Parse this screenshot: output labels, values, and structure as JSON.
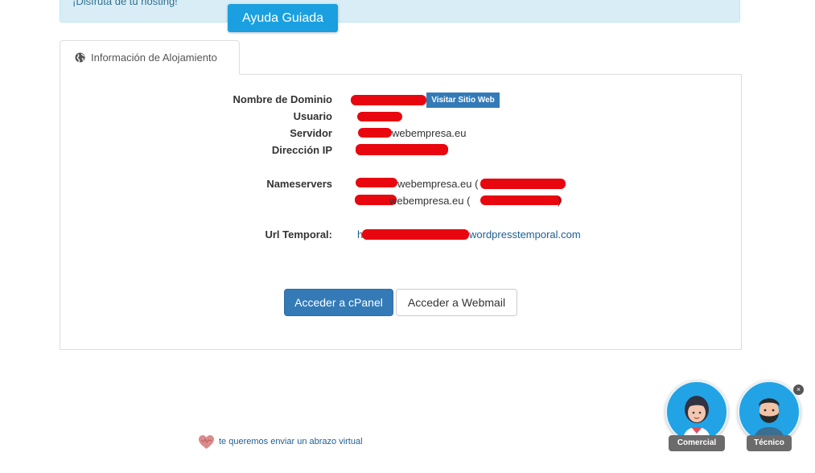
{
  "alert": {
    "text": "¡Disfruta de tu hosting!"
  },
  "guided_help": {
    "label": "Ayuda Guiada"
  },
  "tab": {
    "label": "Información de Alojamiento",
    "icon": "globe-icon"
  },
  "hosting_info": {
    "domain_label": "Nombre de Dominio",
    "visit_site_label": "Visitar Sitio Web",
    "user_label": "Usuario",
    "server_label": "Servidor",
    "server_value": "webempresa.eu",
    "ip_label": "Dirección IP",
    "nameservers_label": "Nameservers",
    "ns1_value": "webempresa.eu (",
    "ns2_value": "webempresa.eu (",
    "ns2_tail": ")",
    "temp_url_label": "Url Temporal:",
    "temp_url_prefix": "h",
    "temp_url_value": "wordpresstemporal.com"
  },
  "actions": {
    "cpanel_label": "Acceder a cPanel",
    "webmail_label": "Acceder a Webmail"
  },
  "footer": {
    "hug_text": "te queremos enviar un abrazo virtual",
    "hug_icon": "heart-icon"
  },
  "chat_agents": [
    {
      "label": "Comercial",
      "icon": "woman-avatar-icon"
    },
    {
      "label": "Técnico",
      "icon": "bearded-man-avatar-icon"
    }
  ],
  "chat_close": {
    "label": "×"
  },
  "colors": {
    "alert_bg": "#d9edf7",
    "guided_btn": "#1aa0e0",
    "primary": "#337ab7",
    "redaction": "#e8070f",
    "link": "#1f5f91"
  }
}
